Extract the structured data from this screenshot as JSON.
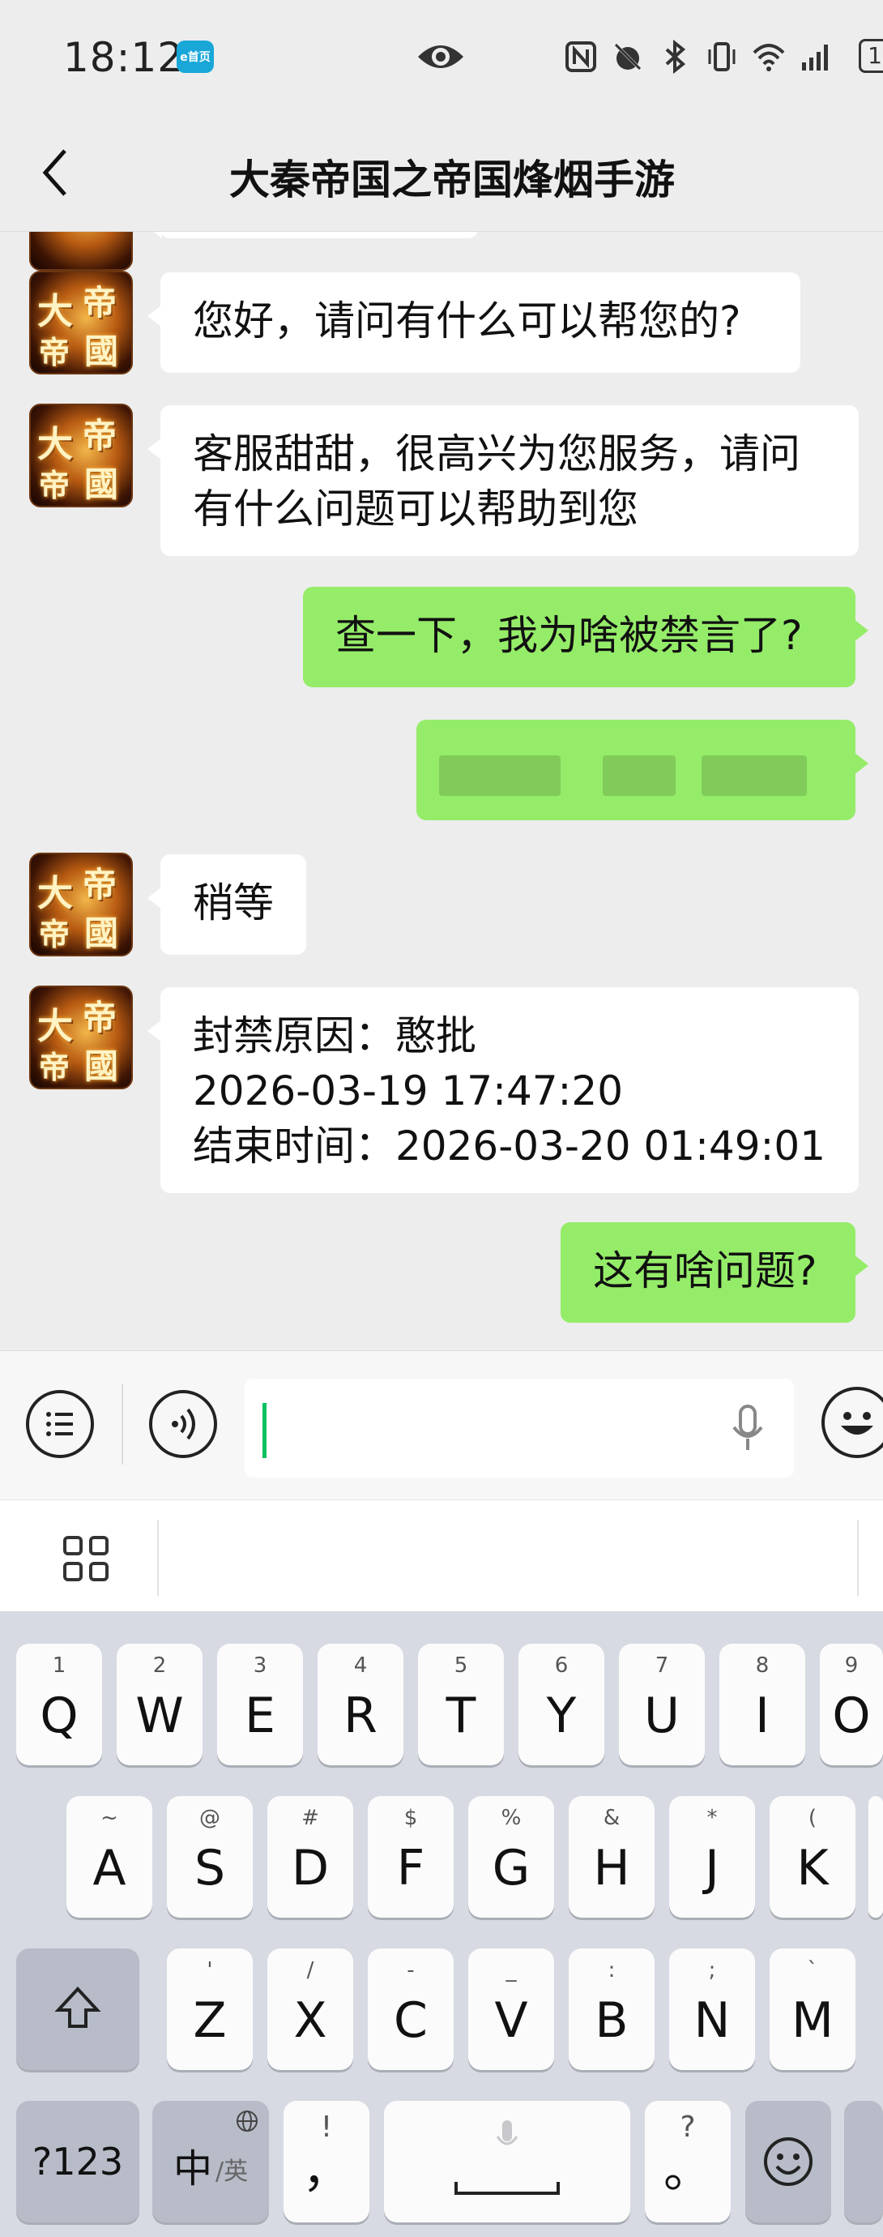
{
  "status_bar": {
    "time": "18:12",
    "app_badge": "e首页",
    "battery": "1"
  },
  "nav": {
    "title": "大秦帝国之帝国烽烟手游"
  },
  "messages": [
    {
      "sender": "service",
      "text": "您好，请问有什么可以帮您的?"
    },
    {
      "sender": "service",
      "lines": [
        "客服甜甜，很高兴为您服务，请问",
        "有什么问题可以帮助到您"
      ]
    },
    {
      "sender": "me",
      "text": "查一下，我为啥被禁言了?"
    },
    {
      "sender": "me",
      "text": ""
    },
    {
      "sender": "service",
      "text": "稍等"
    },
    {
      "sender": "service",
      "lines": [
        "封禁原因：憨批",
        "2026-03-19 17:47:20",
        "结束时间：2026-03-20 01:49:01"
      ]
    },
    {
      "sender": "me",
      "text": "这有啥问题?"
    }
  ],
  "avatar_chars": [
    "大",
    "帝",
    "帝",
    "國"
  ],
  "keyboard": {
    "row1": [
      {
        "key": "Q",
        "hint": "1"
      },
      {
        "key": "W",
        "hint": "2"
      },
      {
        "key": "E",
        "hint": "3"
      },
      {
        "key": "R",
        "hint": "4"
      },
      {
        "key": "T",
        "hint": "5"
      },
      {
        "key": "Y",
        "hint": "6"
      },
      {
        "key": "U",
        "hint": "7"
      },
      {
        "key": "I",
        "hint": "8"
      },
      {
        "key": "O",
        "hint": "9"
      }
    ],
    "row2": [
      {
        "key": "A",
        "hint": "~"
      },
      {
        "key": "S",
        "hint": "@"
      },
      {
        "key": "D",
        "hint": "#"
      },
      {
        "key": "F",
        "hint": "$"
      },
      {
        "key": "G",
        "hint": "%"
      },
      {
        "key": "H",
        "hint": "&"
      },
      {
        "key": "J",
        "hint": "*"
      },
      {
        "key": "K",
        "hint": "("
      }
    ],
    "row3": [
      {
        "key": "Z",
        "hint": "'"
      },
      {
        "key": "X",
        "hint": "/"
      },
      {
        "key": "C",
        "hint": "-"
      },
      {
        "key": "V",
        "hint": "_"
      },
      {
        "key": "B",
        "hint": ":"
      },
      {
        "key": "N",
        "hint": ";"
      },
      {
        "key": "M",
        "hint": "`"
      }
    ],
    "numbers_key": "?123",
    "lang_key_main": "中",
    "lang_key_sub": "/英",
    "comma_key": "，",
    "comma_hint": "!",
    "period_key": "。",
    "period_hint": "?"
  },
  "colors": {
    "my_bubble": "#95ec69",
    "their_bubble": "#ffffff",
    "chat_bg": "#ededed",
    "cursor": "#07c160"
  }
}
